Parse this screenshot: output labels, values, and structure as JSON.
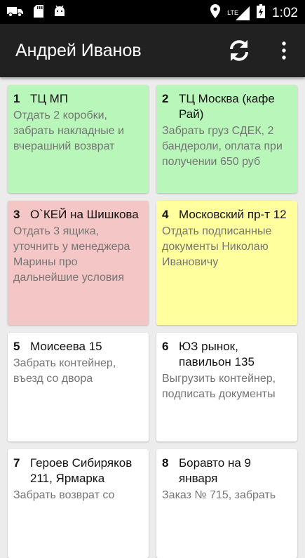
{
  "status_bar": {
    "icons_left": [
      "truck-icon",
      "sd-card-icon",
      "android-icon"
    ],
    "network": "LTE",
    "time": "1:02"
  },
  "app_bar": {
    "title": "Андрей Иванов",
    "actions": [
      "refresh-icon",
      "more-vert-icon"
    ]
  },
  "colors": {
    "green": "#b9f6b9",
    "red": "#f5c6c6",
    "yellow": "#ffff9e",
    "white": "#ffffff",
    "app_bar": "#212121"
  },
  "tasks": [
    {
      "number": "1",
      "address": "ТЦ МП",
      "description": "Отдать 2 коробки, забрать накладные и вчерашний возврат",
      "color": "green"
    },
    {
      "number": "2",
      "address": "ТЦ Москва (кафе Рай)",
      "description": "Забрать груз СДЕК, 2 бандероли, оплата при получении 650 руб",
      "color": "green"
    },
    {
      "number": "3",
      "address": "О`КЕЙ на Шишкова",
      "description": "Отдать 3 ящика, уточнить у менеджера Марины про дальнейшие условия",
      "color": "red"
    },
    {
      "number": "4",
      "address": "Московский пр-т 12",
      "description": "Отдать подписанные документы Николаю Ивановичу",
      "color": "yellow"
    },
    {
      "number": "5",
      "address": "Моисеева 15",
      "description": "Забрать контейнер, въезд со двора",
      "color": "white"
    },
    {
      "number": "6",
      "address": "ЮЗ рынок, павильон 135",
      "description": "Выгрузить контейнер, подписать документы",
      "color": "white"
    },
    {
      "number": "7",
      "address": "Героев Сибиряков 211, Ярмарка",
      "description": "Забрать возврат со",
      "color": "white"
    },
    {
      "number": "8",
      "address": "Боравто на 9 января",
      "description": "Заказ № 715, забрать",
      "color": "white"
    }
  ]
}
